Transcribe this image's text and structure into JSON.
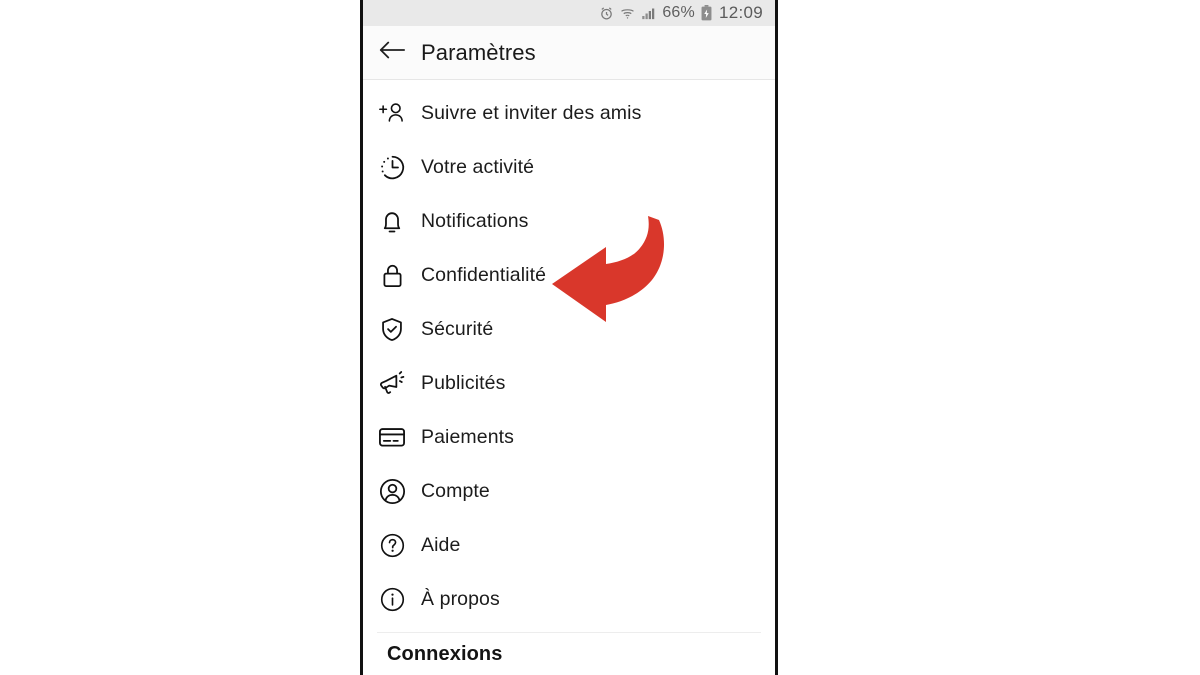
{
  "status_bar": {
    "alarm_icon": "alarm-clock-icon",
    "wifi_icon": "wifi-icon",
    "signal_icon": "cellular-signal-icon",
    "battery_percent": "66%",
    "battery_icon": "battery-charging-icon",
    "time": "12:09"
  },
  "app_bar": {
    "back_icon": "back-arrow-icon",
    "title": "Paramètres"
  },
  "settings": {
    "items": [
      {
        "icon": "person-add-icon",
        "label": "Suivre et inviter des amis"
      },
      {
        "icon": "activity-clock-icon",
        "label": "Votre activité"
      },
      {
        "icon": "bell-icon",
        "label": "Notifications"
      },
      {
        "icon": "lock-icon",
        "label": "Confidentialité"
      },
      {
        "icon": "shield-check-icon",
        "label": "Sécurité"
      },
      {
        "icon": "megaphone-icon",
        "label": "Publicités"
      },
      {
        "icon": "credit-card-icon",
        "label": "Paiements"
      },
      {
        "icon": "account-circle-icon",
        "label": "Compte"
      },
      {
        "icon": "help-circle-icon",
        "label": "Aide"
      },
      {
        "icon": "info-circle-icon",
        "label": "À propos"
      }
    ],
    "section_header": "Connexions"
  },
  "annotation": {
    "arrow_icon": "red-curved-arrow-icon",
    "arrow_color": "#d9372b",
    "points_at": "Confidentialité"
  },
  "colors": {
    "status_bar_bg": "#e9e9e9",
    "app_bar_bg": "#fbfbfb",
    "page_bg": "#ffffff",
    "text_primary": "#1c1c1c",
    "accent_red": "#d9372b"
  }
}
